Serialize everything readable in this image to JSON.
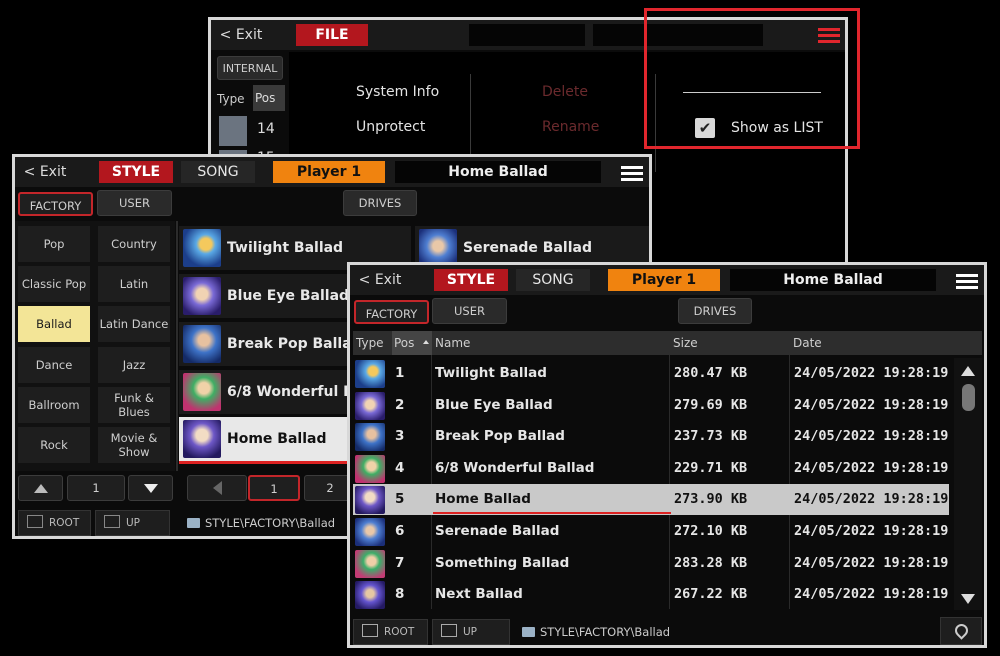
{
  "back_window": {
    "exit": "< Exit",
    "tab_file": "FILE",
    "internal": "INTERNAL",
    "col_type": "Type",
    "col_pos": "Pos",
    "row_pos_1": "14",
    "row_pos_2": "15",
    "menu": {
      "system_info": "System Info",
      "unprotect": "Unprotect",
      "delete": "Delete",
      "rename": "Rename",
      "show_as_list": "Show as LIST",
      "show_as_list_checked": true
    },
    "highlight_color": "#e1262d"
  },
  "grid_window": {
    "exit": "< Exit",
    "tab_style": "STYLE",
    "tab_song": "SONG",
    "player": "Player 1",
    "title": "Home Ballad",
    "factory": "FACTORY",
    "user": "USER",
    "drives": "DRIVES",
    "genres": [
      "Pop",
      "Country",
      "Classic Pop",
      "Latin",
      "Ballad",
      "Latin Dance",
      "Dance",
      "Jazz",
      "Ballroom",
      "Funk & Blues",
      "Rock",
      "Movie & Show"
    ],
    "selected_genre": "Ballad",
    "tiles": [
      "Twilight Ballad",
      "Serenade Ballad",
      "Blue Eye Ballad",
      "Break Pop Ballad",
      "6/8 Wonderful Ballad",
      "Home Ballad"
    ],
    "selected_tile": "Home Ballad",
    "genre_page": "1",
    "pages": [
      "1",
      "2"
    ],
    "root": "ROOT",
    "up": "UP",
    "path": "STYLE\\FACTORY\\Ballad"
  },
  "list_window": {
    "exit": "< Exit",
    "tab_style": "STYLE",
    "tab_song": "SONG",
    "player": "Player 1",
    "title": "Home Ballad",
    "factory": "FACTORY",
    "user": "USER",
    "drives": "DRIVES",
    "columns": {
      "type": "Type",
      "pos": "Pos",
      "name": "Name",
      "size": "Size",
      "date": "Date"
    },
    "rows": [
      {
        "pos": "1",
        "name": "Twilight Ballad",
        "size": "280.47 KB",
        "date": "24/05/2022 19:28:19"
      },
      {
        "pos": "2",
        "name": "Blue Eye Ballad",
        "size": "279.69 KB",
        "date": "24/05/2022 19:28:19"
      },
      {
        "pos": "3",
        "name": "Break Pop Ballad",
        "size": "237.73 KB",
        "date": "24/05/2022 19:28:19"
      },
      {
        "pos": "4",
        "name": "6/8 Wonderful Ballad",
        "size": "229.71 KB",
        "date": "24/05/2022 19:28:19"
      },
      {
        "pos": "5",
        "name": "Home Ballad",
        "size": "273.90 KB",
        "date": "24/05/2022 19:28:19"
      },
      {
        "pos": "6",
        "name": "Serenade Ballad",
        "size": "272.10 KB",
        "date": "24/05/2022 19:28:19"
      },
      {
        "pos": "7",
        "name": "Something Ballad",
        "size": "283.28 KB",
        "date": "24/05/2022 19:28:19"
      },
      {
        "pos": "8",
        "name": "Next Ballad",
        "size": "267.22 KB",
        "date": "24/05/2022 19:28:19"
      }
    ],
    "selected_pos": "5",
    "root": "ROOT",
    "up": "UP",
    "path": "STYLE\\FACTORY\\Ballad"
  }
}
